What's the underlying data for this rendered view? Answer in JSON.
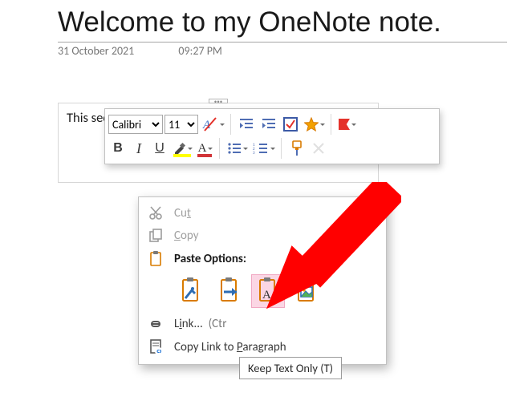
{
  "title": "Welcome to my OneNote note.",
  "date": "31 October 2021",
  "time": "09:27 PM",
  "body_snippet": "This secti",
  "toolbar": {
    "font_name": "Calibri",
    "font_size": "11",
    "bold": "B",
    "italic": "I",
    "underline": "U",
    "bullets_options": "1 2 3"
  },
  "menu": {
    "cut": "Cut",
    "copy": "Copy",
    "paste_hdr": "Paste Options:",
    "link": "Link...",
    "link_accel": "(Ctr",
    "copy_link": "Copy Link to Paragraph",
    "tooltip": "Keep Text Only (T)"
  },
  "icons": {
    "cut": "scissors",
    "copy": "copy",
    "paste": "clipboard",
    "link": "link",
    "copyp": "page-link",
    "styles": "A-slash",
    "eraser": "eraser",
    "indent_dec": "dedent",
    "indent_inc": "indent",
    "todo": "checkbox",
    "star": "star",
    "flag": "flag",
    "highlighter": "pen",
    "fontcolor": "A",
    "bullets": "bullets",
    "numbered": "numbers",
    "painter": "brush",
    "delete": "x",
    "paste_source": "brush",
    "paste_merge": "arrow",
    "paste_text": "A",
    "paste_image": "picture"
  }
}
